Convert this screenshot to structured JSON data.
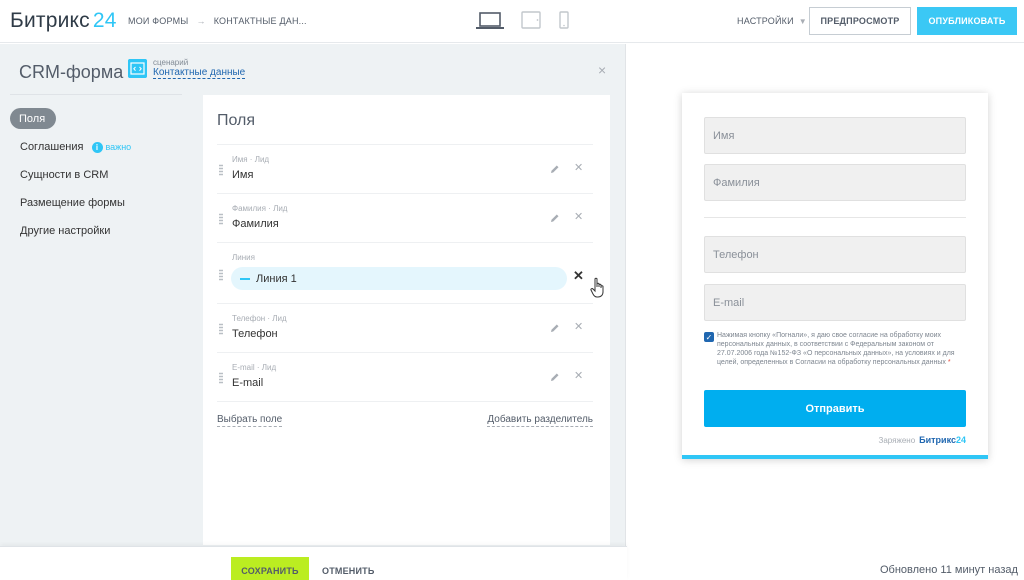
{
  "header": {
    "logo_text": "Битрикс",
    "logo_num": "24",
    "breadcrumbs": [
      "МОИ ФОРМЫ",
      "КОНТАКТНЫЕ ДАН..."
    ],
    "breadcrumb_sep": "→",
    "settings_label": "НАСТРОЙКИ",
    "preview_label": "ПРЕДПРОСМОТР",
    "publish_label": "ОПУБЛИКОВАТЬ",
    "active_device": "laptop-icon"
  },
  "editor": {
    "title": "CRM-форма",
    "scenario_caption": "сценарий",
    "scenario_value": "Контактные данные",
    "close_glyph": "×"
  },
  "sidebar": {
    "items": [
      {
        "label": "Поля",
        "active": true
      },
      {
        "label": "Соглашения",
        "badge": "важно"
      },
      {
        "label": "Сущности в CRM"
      },
      {
        "label": "Размещение формы"
      },
      {
        "label": "Другие настройки"
      }
    ]
  },
  "fields": {
    "title": "Поля",
    "rows": [
      {
        "caption": "Имя · Лид",
        "value": "Имя"
      },
      {
        "caption": "Фамилия · Лид",
        "value": "Фамилия"
      },
      {
        "caption": "Линия",
        "value": "Линия 1"
      },
      {
        "caption": "Телефон · Лид",
        "value": "Телефон"
      },
      {
        "caption": "E-mail · Лид",
        "value": "E-mail"
      }
    ],
    "choose_field": "Выбрать поле",
    "add_separator": "Добавить разделитель"
  },
  "bottom": {
    "save_label": "СОХРАНИТЬ",
    "cancel_label": "ОТМЕНИТЬ",
    "updated_text": "Обновлено 11 минут назад"
  },
  "preview": {
    "placeholders": [
      "Имя",
      "Фамилия",
      "Телефон",
      "E-mail"
    ],
    "consent_text": "Нажимая кнопку «Погнали», я даю свое согласие на обработку моих персональных данных, в соответствии с Федеральным законом от 27.07.2006 года №152-ФЗ «О персональных данных», на условиях и для целей, определенных в Согласии на обработку персональных данных",
    "consent_star": "*",
    "submit_label": "Отправить",
    "powered_caption": "Заряжено",
    "powered_brand": "Битрикс",
    "powered_num": "24"
  }
}
